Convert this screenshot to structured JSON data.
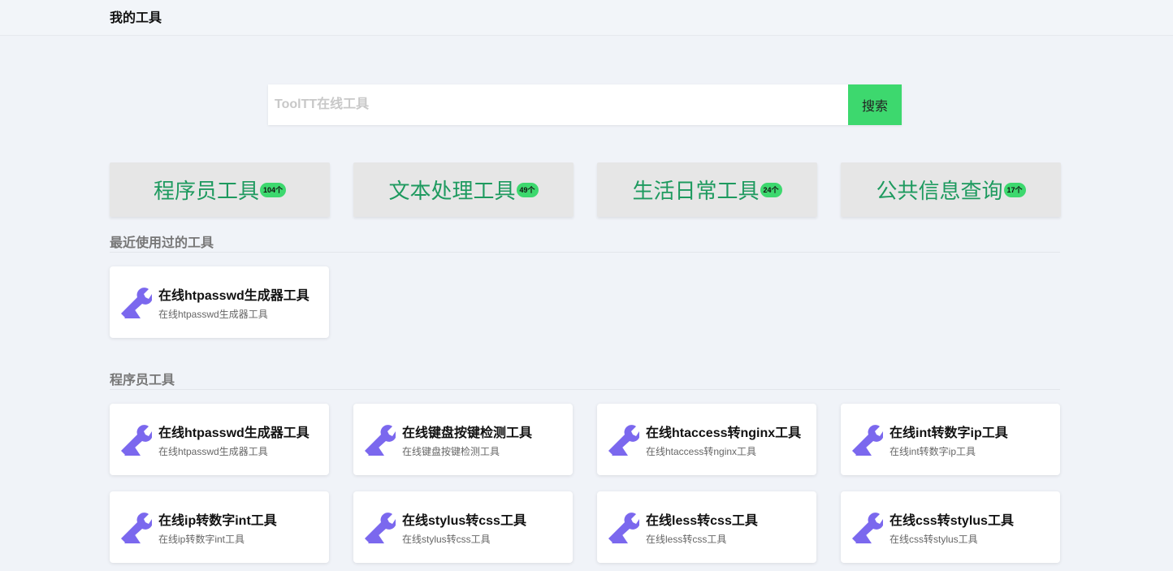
{
  "header": {
    "title": "我的工具"
  },
  "search": {
    "placeholder": "ToolTT在线工具",
    "button_label": "搜索"
  },
  "categories": [
    {
      "label": "程序员工具",
      "count": "104个"
    },
    {
      "label": "文本处理工具",
      "count": "49个"
    },
    {
      "label": "生活日常工具",
      "count": "24个"
    },
    {
      "label": "公共信息查询",
      "count": "17个"
    }
  ],
  "recent": {
    "title": "最近使用过的工具",
    "tools": [
      {
        "name": "在线htpasswd生成器工具",
        "desc": "在线htpasswd生成器工具"
      }
    ]
  },
  "programmer": {
    "title": "程序员工具",
    "tools": [
      {
        "name": "在线htpasswd生成器工具",
        "desc": "在线htpasswd生成器工具"
      },
      {
        "name": "在线键盘按键检测工具",
        "desc": "在线键盘按键检测工具"
      },
      {
        "name": "在线htaccess转nginx工具",
        "desc": "在线htaccess转nginx工具"
      },
      {
        "name": "在线int转数字ip工具",
        "desc": "在线int转数字ip工具"
      },
      {
        "name": "在线ip转数字int工具",
        "desc": "在线ip转数字int工具"
      },
      {
        "name": "在线stylus转css工具",
        "desc": "在线stylus转css工具"
      },
      {
        "name": "在线less转css工具",
        "desc": "在线less转css工具"
      },
      {
        "name": "在线css转stylus工具",
        "desc": "在线css转stylus工具"
      }
    ]
  },
  "colors": {
    "accent": "#3dd86e",
    "category_text": "#1e9a5f",
    "icon": "#7b68ee"
  },
  "icon_name": "wrench-icon"
}
